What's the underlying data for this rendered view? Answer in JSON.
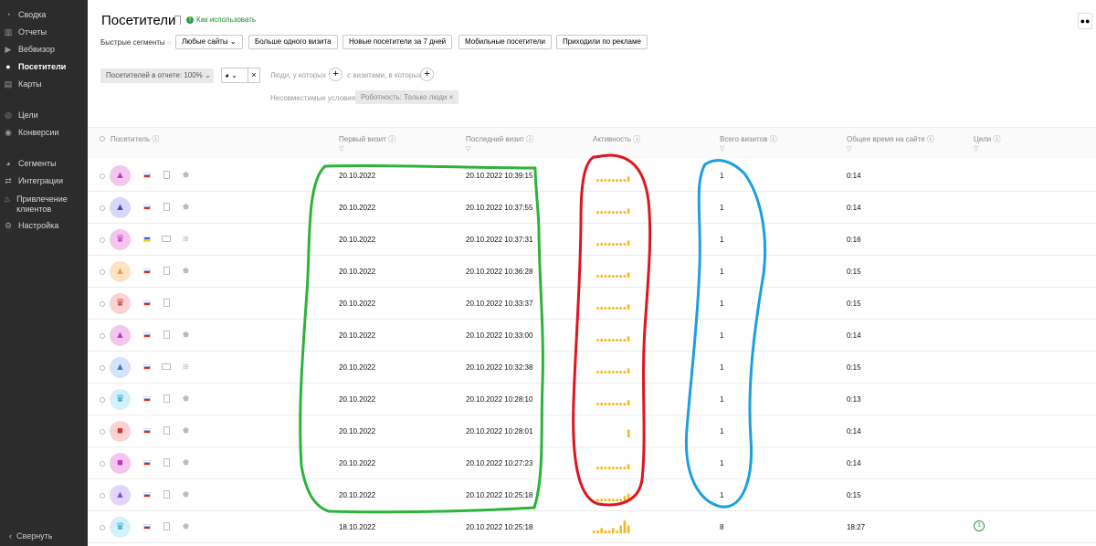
{
  "sidebar": {
    "items": [
      {
        "label": "Сводка",
        "icon": "dashboard-icon",
        "glyph": "◔"
      },
      {
        "label": "Отчеты",
        "icon": "reports-icon",
        "glyph": "▥"
      },
      {
        "label": "Вебвизор",
        "icon": "play-icon",
        "glyph": "▶"
      },
      {
        "label": "Посетители",
        "icon": "user-icon",
        "glyph": "●"
      },
      {
        "label": "Карты",
        "icon": "map-icon",
        "glyph": "▤"
      },
      {
        "label": "Цели",
        "icon": "target-icon",
        "glyph": "◎"
      },
      {
        "label": "Конверсии",
        "icon": "conversions-icon",
        "glyph": "◉"
      },
      {
        "label": "Сегменты",
        "icon": "segments-icon",
        "glyph": "◕"
      },
      {
        "label": "Интеграции",
        "icon": "integrations-icon",
        "glyph": "⇄"
      },
      {
        "label": "Привлечение клиентов",
        "icon": "flame-icon",
        "glyph": "♨"
      },
      {
        "label": "Настройка",
        "icon": "gear-icon",
        "glyph": "⚙"
      }
    ],
    "active_index": 3,
    "collapse_label": "Свернуть"
  },
  "header": {
    "title": "Посетители",
    "howto_label": "Как использовать"
  },
  "quick_segments": {
    "label": "Быстрые сегменты",
    "buttons": [
      "Любые сайты",
      "Больше одного визита",
      "Новые посетители за 7 дней",
      "Мобильные посетители",
      "Приходили по рекламе"
    ]
  },
  "filters": {
    "visitors_in_report": "Посетителей в отчете: 100%",
    "people_who": "Люди, у которых",
    "with_visits_where": "с визитами, в которых",
    "incompatible_label": "Несовместимые условия:",
    "incompatible_tag": "Роботность: Только люди"
  },
  "table": {
    "columns": [
      "Посетитель",
      "Первый визит",
      "Последний визит",
      "Активность",
      "Всего визитов",
      "Общее время на сайте",
      "Цели"
    ],
    "rows": [
      {
        "avatar_color": "#f3c6f0",
        "avatar_fg": "#c733c0",
        "avatar_glyph": "▲",
        "flag": "ru",
        "device": "mobile",
        "os": "android",
        "first": "20.10.2022",
        "last": "20.10.2022 10:39:15",
        "activity": [
          0,
          1,
          1,
          1,
          1,
          1,
          1,
          1,
          1,
          2
        ],
        "visits": "1",
        "time": "0:14",
        "goals": ""
      },
      {
        "avatar_color": "#d9d6fb",
        "avatar_fg": "#5142c9",
        "avatar_glyph": "▲",
        "flag": "ru",
        "device": "mobile",
        "os": "android",
        "first": "20.10.2022",
        "last": "20.10.2022 10:37:55",
        "activity": [
          0,
          1,
          1,
          1,
          1,
          1,
          1,
          1,
          1,
          2
        ],
        "visits": "1",
        "time": "0:14",
        "goals": ""
      },
      {
        "avatar_color": "#f3c6f0",
        "avatar_fg": "#c733c0",
        "avatar_glyph": "♛",
        "flag": "ua",
        "device": "desktop",
        "os": "windows",
        "first": "20.10.2022",
        "last": "20.10.2022 10:37:31",
        "activity": [
          0,
          1,
          1,
          1,
          1,
          1,
          1,
          1,
          1,
          2
        ],
        "visits": "1",
        "time": "0:16",
        "goals": ""
      },
      {
        "avatar_color": "#fde2c4",
        "avatar_fg": "#f0a133",
        "avatar_glyph": "▲",
        "flag": "ru",
        "device": "mobile",
        "os": "android",
        "first": "20.10.2022",
        "last": "20.10.2022 10:36:28",
        "activity": [
          0,
          1,
          1,
          1,
          1,
          1,
          1,
          1,
          1,
          2
        ],
        "visits": "1",
        "time": "0:15",
        "goals": ""
      },
      {
        "avatar_color": "#fbd3d3",
        "avatar_fg": "#d63434",
        "avatar_glyph": "♛",
        "flag": "ru",
        "device": "mobile",
        "os": "apple",
        "first": "20.10.2022",
        "last": "20.10.2022 10:33:37",
        "activity": [
          0,
          1,
          1,
          1,
          1,
          1,
          1,
          1,
          1,
          2
        ],
        "visits": "1",
        "time": "0:15",
        "goals": ""
      },
      {
        "avatar_color": "#f3c6f0",
        "avatar_fg": "#c733c0",
        "avatar_glyph": "▲",
        "flag": "ru",
        "device": "mobile",
        "os": "android",
        "first": "20.10.2022",
        "last": "20.10.2022 10:33:00",
        "activity": [
          0,
          1,
          1,
          1,
          1,
          1,
          1,
          1,
          1,
          2
        ],
        "visits": "1",
        "time": "0:14",
        "goals": ""
      },
      {
        "avatar_color": "#d4e4fb",
        "avatar_fg": "#3a7bd5",
        "avatar_glyph": "▲",
        "flag": "ru",
        "device": "desktop",
        "os": "windows",
        "first": "20.10.2022",
        "last": "20.10.2022 10:32:38",
        "activity": [
          0,
          1,
          1,
          1,
          1,
          1,
          1,
          1,
          1,
          2
        ],
        "visits": "1",
        "time": "0:15",
        "goals": ""
      },
      {
        "avatar_color": "#d3f0fb",
        "avatar_fg": "#2aa5dc",
        "avatar_glyph": "♛",
        "flag": "ru",
        "device": "mobile",
        "os": "android",
        "first": "20.10.2022",
        "last": "20.10.2022 10:28:10",
        "activity": [
          0,
          1,
          1,
          1,
          1,
          1,
          1,
          1,
          1,
          2
        ],
        "visits": "1",
        "time": "0:13",
        "goals": ""
      },
      {
        "avatar_color": "#fbd3d3",
        "avatar_fg": "#d63434",
        "avatar_glyph": "■",
        "flag": "ru",
        "device": "mobile",
        "os": "android",
        "first": "20.10.2022",
        "last": "20.10.2022 10:28:01",
        "activity": [
          0,
          0,
          0,
          0,
          0,
          0,
          0,
          0,
          0,
          3
        ],
        "visits": "1",
        "time": "0:14",
        "goals": ""
      },
      {
        "avatar_color": "#f3c6f0",
        "avatar_fg": "#c733c0",
        "avatar_glyph": "■",
        "flag": "ru",
        "device": "mobile",
        "os": "android",
        "first": "20.10.2022",
        "last": "20.10.2022 10:27:23",
        "activity": [
          0,
          1,
          1,
          1,
          1,
          1,
          1,
          1,
          1,
          2
        ],
        "visits": "1",
        "time": "0:14",
        "goals": ""
      },
      {
        "avatar_color": "#e3d6fb",
        "avatar_fg": "#8c4bd6",
        "avatar_glyph": "▲",
        "flag": "ru",
        "device": "mobile",
        "os": "android",
        "first": "20.10.2022",
        "last": "20.10.2022 10:25:18",
        "activity": [
          0,
          1,
          1,
          1,
          1,
          1,
          1,
          1,
          2,
          3
        ],
        "visits": "1",
        "time": "0:15",
        "goals": ""
      },
      {
        "avatar_color": "#d3f0fb",
        "avatar_fg": "#2aa5dc",
        "avatar_glyph": "♛",
        "flag": "ru",
        "device": "mobile",
        "os": "android",
        "first": "18.10.2022",
        "last": "20.10.2022 10:25:18",
        "activity": [
          1,
          1,
          2,
          1,
          1,
          2,
          1,
          3,
          5,
          3
        ],
        "visits": "8",
        "time": "18:27",
        "goals": "1"
      }
    ]
  },
  "colors": {
    "sidebar_bg": "#2c2c2c",
    "spark": "#f5b820",
    "annotation_green": "#2bb33a",
    "annotation_red": "#e0141e",
    "annotation_blue": "#1a9fe0"
  }
}
